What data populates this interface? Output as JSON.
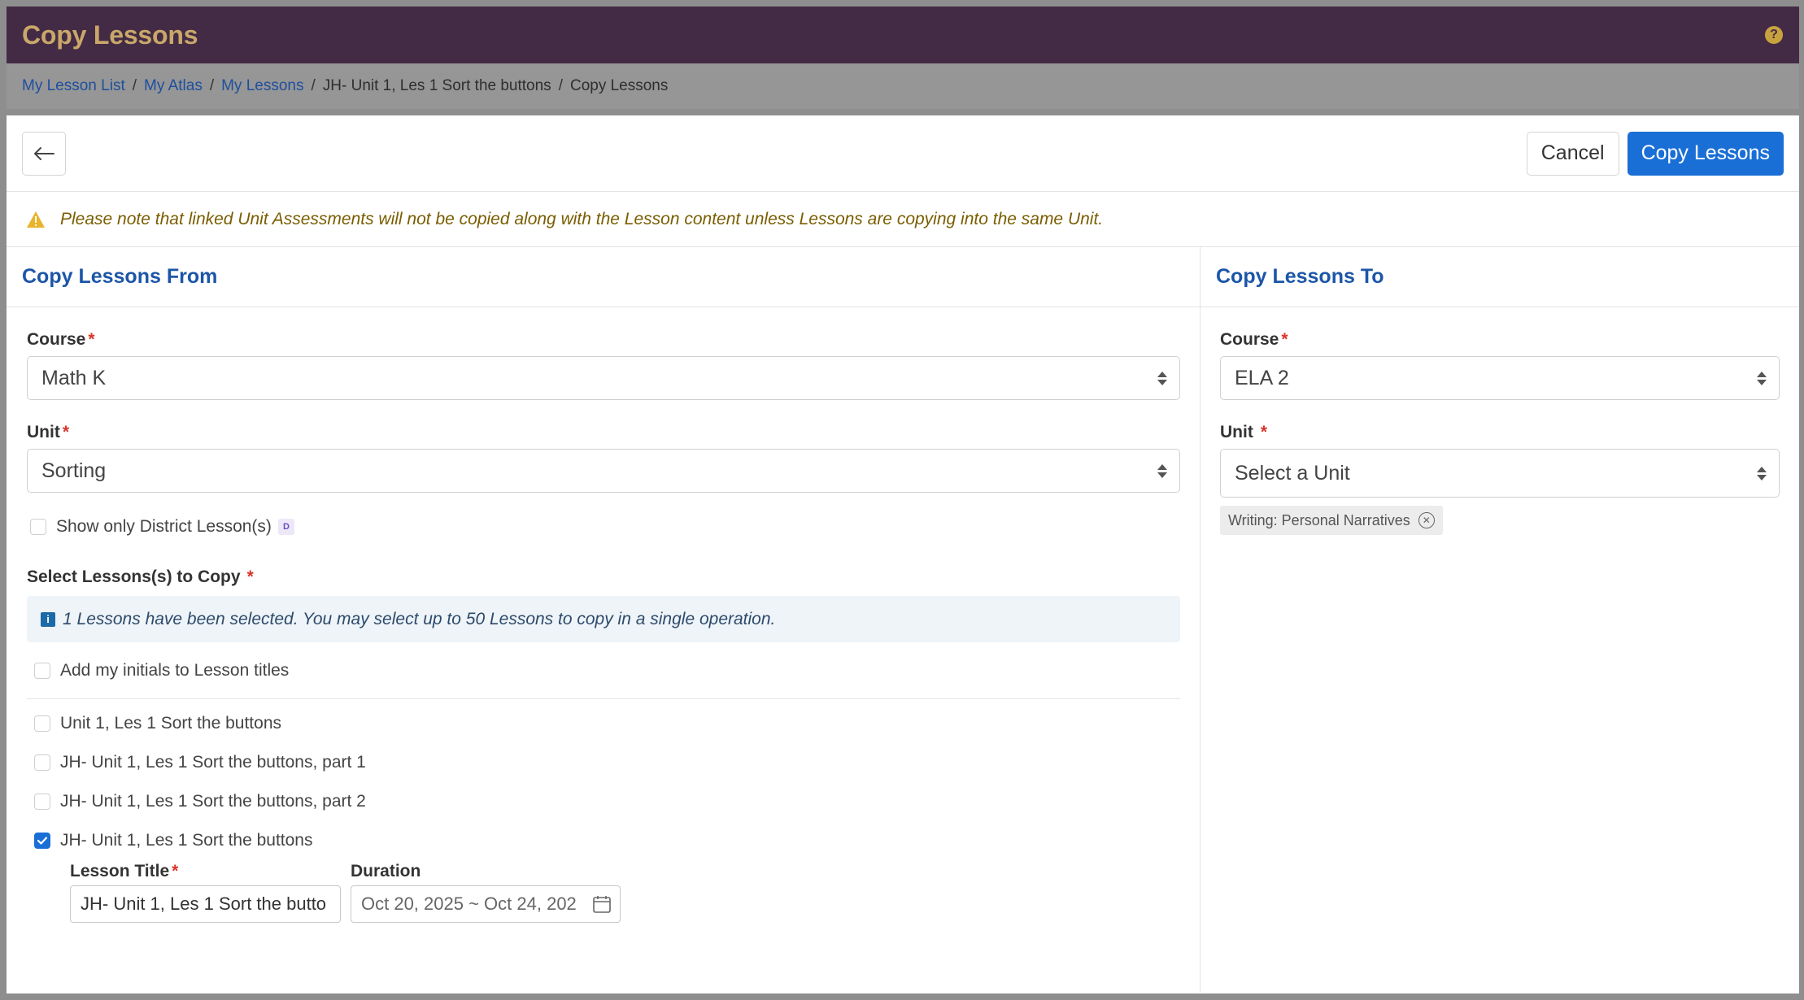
{
  "app": {
    "title": "Copy Lessons"
  },
  "breadcrumb": {
    "items": [
      "My Lesson List",
      "My Atlas",
      "My Lessons",
      "JH- Unit 1, Les 1 Sort the buttons"
    ],
    "current": "Copy Lessons"
  },
  "toolbar": {
    "cancel_label": "Cancel",
    "copy_label": "Copy Lessons"
  },
  "warning": {
    "text": "Please note that linked Unit Assessments will not be copied along with the Lesson content unless Lessons are copying into the same Unit."
  },
  "from": {
    "heading": "Copy Lessons From",
    "course_label": "Course",
    "course_value": "Math K",
    "unit_label": "Unit",
    "unit_value": "Sorting",
    "district_only_label": "Show only District Lesson(s)",
    "district_badge": "D",
    "select_label": "Select Lessons(s) to Copy",
    "info_text": "1 Lessons have been selected. You may select up to 50 Lessons to copy in a single operation.",
    "initials_label": "Add my initials to Lesson titles",
    "lessons": [
      {
        "label": "Unit 1, Les 1 Sort the buttons",
        "checked": false
      },
      {
        "label": "JH- Unit 1, Les 1 Sort the buttons, part 1",
        "checked": false
      },
      {
        "label": "JH- Unit 1, Les 1 Sort the buttons, part 2",
        "checked": false
      },
      {
        "label": "JH- Unit 1, Les 1 Sort the buttons",
        "checked": true
      }
    ],
    "lesson_title_label": "Lesson Title",
    "lesson_title_value": "JH- Unit 1, Les 1 Sort the butto",
    "duration_label": "Duration",
    "duration_value": "Oct 20, 2025 ~ Oct 24, 202"
  },
  "to": {
    "heading": "Copy Lessons To",
    "course_label": "Course",
    "course_value": "ELA 2",
    "unit_label": "Unit",
    "unit_placeholder": "Select a Unit",
    "tag_label": "Writing: Personal Narratives"
  },
  "colors": {
    "titlebar": "#432b45",
    "title_text": "#c9a76a",
    "primary": "#1a6fd6",
    "link": "#1d4f9e",
    "warning_text": "#7a5d00"
  }
}
